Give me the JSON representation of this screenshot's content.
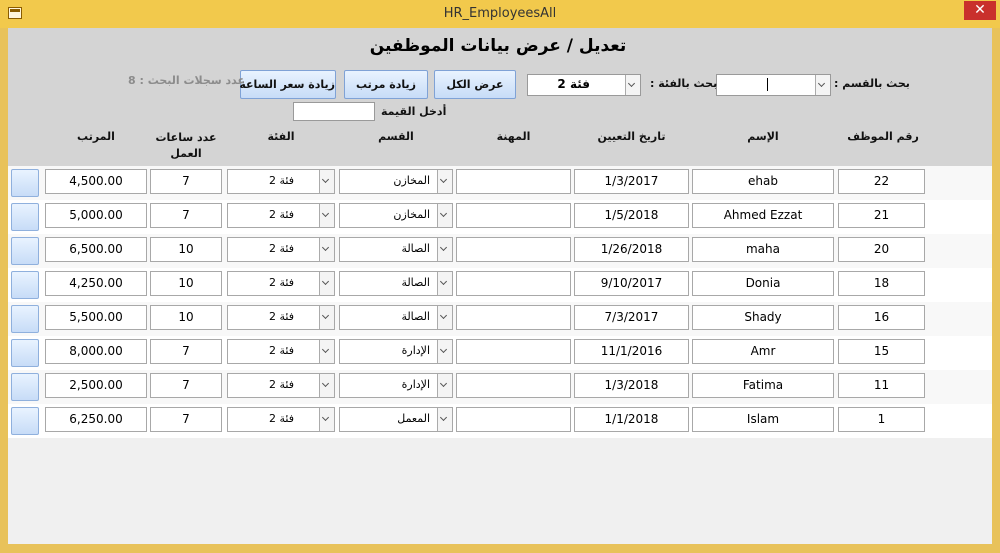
{
  "window": {
    "title": "HR_EmployeesAll",
    "close_glyph": "✕"
  },
  "form": {
    "title": "تعديل / عرض بيانات الموظفين",
    "search_dept_label": "بحث بالقسم :",
    "search_dept_value": "",
    "search_class_label": "بحث بالفئة :",
    "search_class_value": "فئة 2",
    "show_all_label": "عرض الكل",
    "raise_salary_label": "زيادة مرتب",
    "raise_hour_rate_label": "زيادة سعر الساعة",
    "search_count_label": "عدد سجلات البحث : 8",
    "enter_value_label": "أدخل القيمة",
    "enter_value": ""
  },
  "columns": {
    "emp_no": "رقم الموظف",
    "name": "الإسم",
    "hire_date": "تاريخ التعيين",
    "job": "المهنة",
    "dept": "القسم",
    "class": "الفئة",
    "hours": "عدد ساعات العمل",
    "salary": "المرتب"
  },
  "rows": [
    {
      "emp_no": "22",
      "name": "ehab",
      "hire_date": "1/3/2017",
      "job": "",
      "dept": "المخازن",
      "class": "فئة 2",
      "hours": "7",
      "salary": "4,500.00"
    },
    {
      "emp_no": "21",
      "name": "Ahmed Ezzat",
      "hire_date": "1/5/2018",
      "job": "",
      "dept": "المخازن",
      "class": "فئة 2",
      "hours": "7",
      "salary": "5,000.00"
    },
    {
      "emp_no": "20",
      "name": "maha",
      "hire_date": "1/26/2018",
      "job": "",
      "dept": "الصالة",
      "class": "فئة 2",
      "hours": "10",
      "salary": "6,500.00"
    },
    {
      "emp_no": "18",
      "name": "Donia",
      "hire_date": "9/10/2017",
      "job": "",
      "dept": "الصالة",
      "class": "فئة 2",
      "hours": "10",
      "salary": "4,250.00"
    },
    {
      "emp_no": "16",
      "name": "Shady",
      "hire_date": "7/3/2017",
      "job": "",
      "dept": "الصالة",
      "class": "فئة 2",
      "hours": "10",
      "salary": "5,500.00"
    },
    {
      "emp_no": "15",
      "name": "Amr",
      "hire_date": "11/1/2016",
      "job": "",
      "dept": "الإدارة",
      "class": "فئة 2",
      "hours": "7",
      "salary": "8,000.00"
    },
    {
      "emp_no": "11",
      "name": "Fatima",
      "hire_date": "1/3/2018",
      "job": "",
      "dept": "الإدارة",
      "class": "فئة 2",
      "hours": "7",
      "salary": "2,500.00"
    },
    {
      "emp_no": "1",
      "name": "Islam",
      "hire_date": "1/1/2018",
      "job": "",
      "dept": "المعمل",
      "class": "فئة 2",
      "hours": "7",
      "salary": "6,250.00"
    }
  ],
  "colors": {
    "frame": "#f2c94c",
    "header_band": "#d4d4d4",
    "button": "#c7dcf7",
    "close": "#c9302c"
  }
}
